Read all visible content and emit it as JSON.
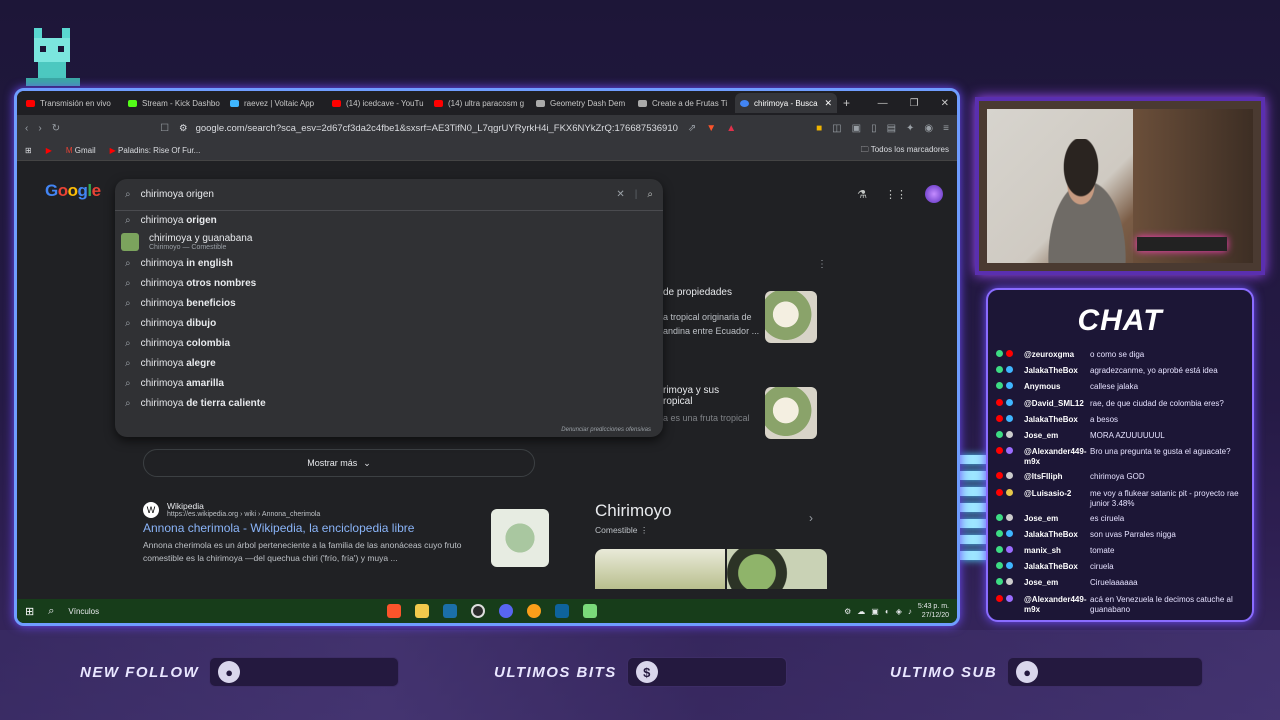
{
  "browser": {
    "tabs": [
      {
        "label": "Transmisión en vivo",
        "color": "#ff0000",
        "active": false
      },
      {
        "label": "Stream - Kick Dashbo",
        "color": "#53fc18",
        "active": false
      },
      {
        "label": "raevez | Voltaic App",
        "color": "#3fb6ff",
        "active": false
      },
      {
        "label": "(14) icedcave - YouTu",
        "color": "#ff0000",
        "active": false
      },
      {
        "label": "(14) ultra paracosm g",
        "color": "#ff0000",
        "active": false
      },
      {
        "label": "Geometry Dash Dem",
        "color": "#aaaaaa",
        "active": false
      },
      {
        "label": "Create a de Frutas Ti",
        "color": "#aaaaaa",
        "active": false
      },
      {
        "label": "chirimoya - Busca",
        "color": "#4285f4",
        "active": true
      }
    ],
    "new_tab": "+",
    "url": "google.com/search?sca_esv=2d67cf3da2c4fbe1&sxsrf=AE3TifN0_L7qgrUYRyrkH4i_FKX6NYkZrQ:1766875369101&q=chiri...",
    "bookmarks": [
      "Gmail",
      "Paladins: Rise Of Fur..."
    ],
    "all_bookmarks": "Todos los marcadores"
  },
  "search": {
    "logo": "Google",
    "query": "chirimoya origen",
    "suggestions": [
      {
        "base": "chirimoya ",
        "bold": "origen"
      },
      {
        "base": "chirimoya y guanabana",
        "bold": "",
        "sub": "Chirimoyo — Comestible",
        "thumb": true
      },
      {
        "base": "chirimoya ",
        "bold": "in english"
      },
      {
        "base": "chirimoya ",
        "bold": "otros nombres"
      },
      {
        "base": "chirimoya ",
        "bold": "beneficios"
      },
      {
        "base": "chirimoya ",
        "bold": "dibujo"
      },
      {
        "base": "chirimoya ",
        "bold": "colombia"
      },
      {
        "base": "chirimoya ",
        "bold": "alegre"
      },
      {
        "base": "chirimoya ",
        "bold": "amarilla"
      },
      {
        "base": "chirimoya ",
        "bold": "de tierra caliente"
      }
    ],
    "report": "Denunciar predicciones ofensivas"
  },
  "results": {
    "card1_title": "de propiedades",
    "card1_text1": "a tropical originaria de",
    "card1_text2": "andina entre Ecuador ...",
    "card2_title1": "rimoya y sus",
    "card2_title2": "ropical",
    "card2_text": "a es una fruta tropical",
    "show_more": "Mostrar más",
    "wiki_source": "Wikipedia",
    "wiki_url": "https://es.wikipedia.org › wiki › Annona_cherimola",
    "wiki_title": "Annona cherimola - Wikipedia, la enciclopedia libre",
    "wiki_desc1": "Annona cherimola es un árbol perteneciente a la familia de las anonáceas cuyo fruto",
    "wiki_desc2": "comestible es la chirimoya —del quechua chiri ('frío, fría') y muya ...",
    "kp_title": "Chirimoyo",
    "kp_sub": "Comestible"
  },
  "taskbar": {
    "search": "Vínculos",
    "time": "5:43 p. m.",
    "date": "27/12/20"
  },
  "chat": {
    "title": "CHAT",
    "messages": [
      {
        "user": "@zeuroxgma",
        "text": "o como se diga",
        "c": "#3ddc84",
        "p": "#ff0000"
      },
      {
        "user": "JalakaTheBox",
        "text": "agradezcanme, yo aprobé está idea",
        "c": "#3ddc84",
        "p": "#3fb6ff"
      },
      {
        "user": "Anymous",
        "text": "callese jalaka",
        "c": "#3ddc84",
        "p": "#3fb6ff"
      },
      {
        "user": "@David_SML12",
        "text": "rae, de que ciudad de colombia eres?",
        "c": "#ff0000",
        "p": "#3fb6ff"
      },
      {
        "user": "JalakaTheBox",
        "text": "a besos",
        "c": "#ff0000",
        "p": "#3fb6ff"
      },
      {
        "user": "Jose_em",
        "text": "MORA AZUUUUUUL",
        "c": "#3ddc84",
        "p": "#cccccc"
      },
      {
        "user": "@Alexander449-m9x",
        "text": "Bro una pregunta te gusta el aguacate?",
        "c": "#ff0000",
        "p": "#9b6cff"
      },
      {
        "user": "@ItsFIliph",
        "text": "chirimoya GOD",
        "c": "#ff0000",
        "p": "#cccccc"
      },
      {
        "user": "@Luisasio-2",
        "text": "me voy a flukear satanic pit - proyecto rae junior 3.48%",
        "c": "#ff0000",
        "p": "#e6c84a"
      },
      {
        "user": "Jose_em",
        "text": "es ciruela",
        "c": "#3ddc84",
        "p": "#cccccc"
      },
      {
        "user": "JalakaTheBox",
        "text": "son uvas Parrales nigga",
        "c": "#3ddc84",
        "p": "#3fb6ff"
      },
      {
        "user": "manix_sh",
        "text": "tomate",
        "c": "#3ddc84",
        "p": "#9b6cff"
      },
      {
        "user": "JalakaTheBox",
        "text": "ciruela",
        "c": "#3ddc84",
        "p": "#3fb6ff"
      },
      {
        "user": "Jose_em",
        "text": "Ciruelaaaaaa",
        "c": "#3ddc84",
        "p": "#cccccc"
      },
      {
        "user": "@Alexander449-m9x",
        "text": "acá en Venezuela le decimos catuche al guanabano",
        "c": "#ff0000",
        "p": "#9b6cff"
      }
    ]
  },
  "overlay": {
    "new_follow": "NEW FOLLOW",
    "ultimos_bits": "ULTIMOS BITS",
    "ultimo_sub": "ULTIMO SUB",
    "bits_symbol": "$"
  }
}
